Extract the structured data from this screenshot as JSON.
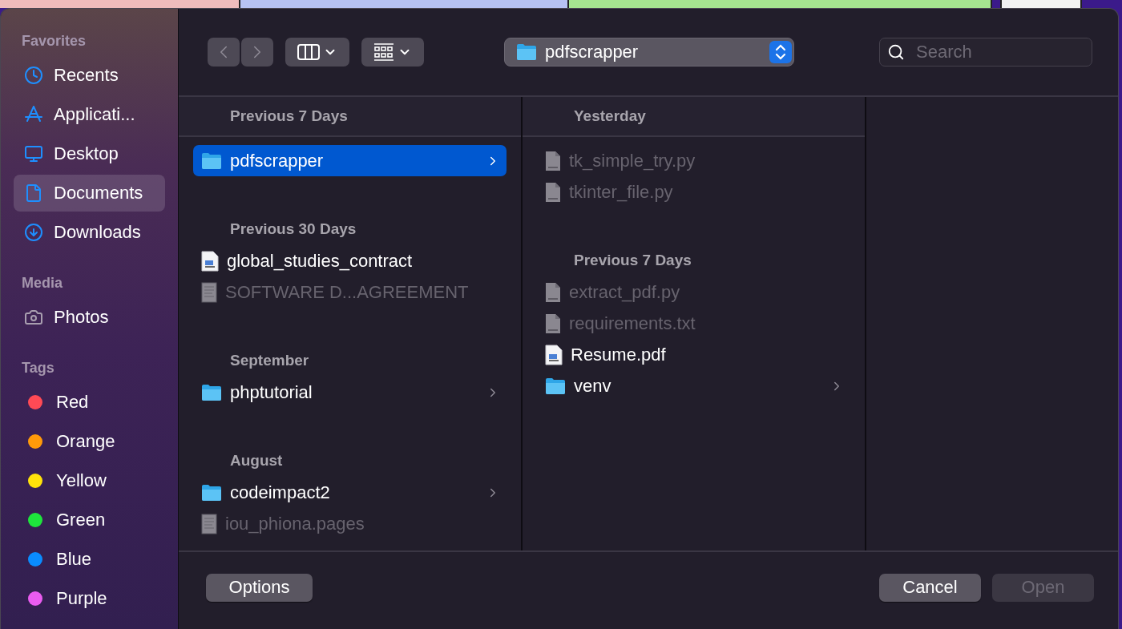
{
  "sidebar": {
    "sections": [
      {
        "title": "Favorites",
        "items": [
          {
            "label": "Recents",
            "kind": "clock",
            "selected": false
          },
          {
            "label": "Applicati...",
            "kind": "apps",
            "selected": false
          },
          {
            "label": "Desktop",
            "kind": "desktop",
            "selected": false
          },
          {
            "label": "Documents",
            "kind": "document",
            "selected": true
          },
          {
            "label": "Downloads",
            "kind": "download",
            "selected": false
          }
        ]
      },
      {
        "title": "Media",
        "items": [
          {
            "label": "Photos",
            "kind": "camera",
            "selected": false
          }
        ]
      },
      {
        "title": "Tags",
        "items": [
          {
            "label": "Red",
            "kind": "tag",
            "color": "#ff4a55",
            "selected": false
          },
          {
            "label": "Orange",
            "kind": "tag",
            "color": "#ff9a0a",
            "selected": false
          },
          {
            "label": "Yellow",
            "kind": "tag",
            "color": "#ffe20a",
            "selected": false
          },
          {
            "label": "Green",
            "kind": "tag",
            "color": "#1ee53c",
            "selected": false
          },
          {
            "label": "Blue",
            "kind": "tag",
            "color": "#0a8cff",
            "selected": false
          },
          {
            "label": "Purple",
            "kind": "tag",
            "color": "#ea5cf0",
            "selected": false
          }
        ]
      }
    ]
  },
  "toolbar": {
    "location": "pdfscrapper",
    "search": {
      "placeholder": "Search"
    }
  },
  "columns": [
    {
      "sections": [
        {
          "title": "Previous 7 Days",
          "items": [
            {
              "name": "pdfscrapper",
              "kind": "folder",
              "disabled": false,
              "selected": true
            }
          ]
        },
        {
          "title": "Previous 30 Days",
          "items": [
            {
              "name": "global_studies_contract",
              "kind": "pdf",
              "disabled": false,
              "selected": false
            },
            {
              "name": "SOFTWARE D...AGREEMENT",
              "kind": "pages",
              "disabled": true,
              "selected": false
            }
          ]
        },
        {
          "title": "September",
          "items": [
            {
              "name": "phptutorial",
              "kind": "folder",
              "disabled": false,
              "selected": false
            }
          ]
        },
        {
          "title": "August",
          "items": [
            {
              "name": "codeimpact2",
              "kind": "folder",
              "disabled": false,
              "selected": false
            },
            {
              "name": "iou_phiona.pages",
              "kind": "pages",
              "disabled": true,
              "selected": false
            }
          ]
        }
      ]
    },
    {
      "sections": [
        {
          "title": "Yesterday",
          "items": [
            {
              "name": "tk_simple_try.py",
              "kind": "python",
              "disabled": true,
              "selected": false
            },
            {
              "name": "tkinter_file.py",
              "kind": "python",
              "disabled": true,
              "selected": false
            }
          ]
        },
        {
          "title": "Previous 7 Days",
          "items": [
            {
              "name": "extract_pdf.py",
              "kind": "python",
              "disabled": true,
              "selected": false
            },
            {
              "name": "requirements.txt",
              "kind": "text",
              "disabled": true,
              "selected": false
            },
            {
              "name": "Resume.pdf",
              "kind": "pdf",
              "disabled": false,
              "selected": false
            },
            {
              "name": "venv",
              "kind": "folder",
              "disabled": false,
              "selected": false
            }
          ]
        }
      ]
    }
  ],
  "footer": {
    "left": [
      {
        "label": "Options",
        "disabled": false
      }
    ],
    "right": [
      {
        "label": "Cancel",
        "disabled": false
      },
      {
        "label": "Open",
        "disabled": true
      }
    ]
  }
}
